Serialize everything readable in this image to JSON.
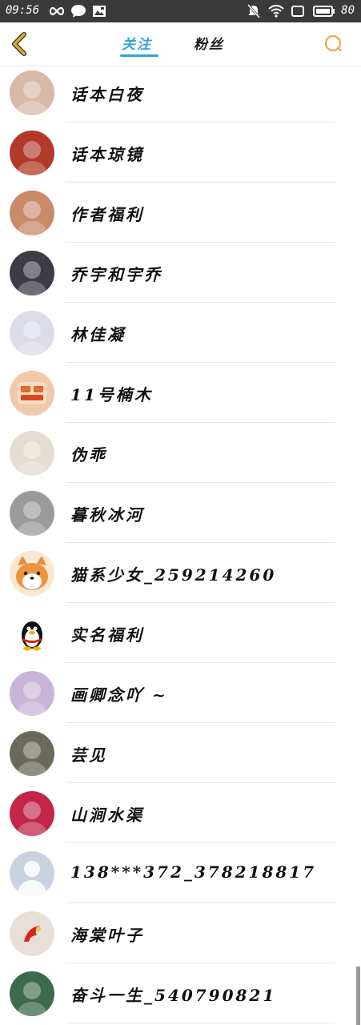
{
  "status_bar": {
    "time": "09:56",
    "battery": "80",
    "icons": [
      "infinity-icon",
      "message-icon",
      "image-icon",
      "mute-icon",
      "wifi-icon",
      "screen-icon",
      "battery-icon"
    ]
  },
  "nav": {
    "back_icon": "chevron-left-icon",
    "tab_follow": "关注",
    "tab_fans": "粉丝",
    "search_icon": "search-icon",
    "accent_color": "#2fa3d7",
    "back_color": "#c49a2a",
    "search_color": "#f0a040"
  },
  "contacts": [
    {
      "name": "话本白夜",
      "avatar_color": "#d8b8a8",
      "avatar_icon": "avatar-girl-red-bow"
    },
    {
      "name": "话本琼镜",
      "avatar_color": "#b33a2a",
      "avatar_icon": "avatar-book-mascot"
    },
    {
      "name": "作者福利",
      "avatar_color": "#c98a6a",
      "avatar_icon": "avatar-anime-girl"
    },
    {
      "name": "乔宇和宇乔",
      "avatar_color": "#3c3c44",
      "avatar_icon": "avatar-photo-dark"
    },
    {
      "name": "林佳凝",
      "avatar_color": "#dcdce8",
      "avatar_icon": "avatar-white-hair-girl"
    },
    {
      "name": "11号楠木",
      "avatar_color": "#f2c8a8",
      "avatar_icon": "avatar-text-logo"
    },
    {
      "name": "伪乖",
      "avatar_color": "#e6ddd2",
      "avatar_icon": "avatar-sketch-girl"
    },
    {
      "name": "暮秋冰河",
      "avatar_color": "#9a9a9a",
      "avatar_icon": "avatar-boy-hat"
    },
    {
      "name": "猫系少女_259214260",
      "avatar_color": "#f0a060",
      "avatar_icon": "avatar-shiba-dog"
    },
    {
      "name": "实名福利",
      "avatar_color": "#ffffff",
      "avatar_icon": "avatar-qq-penguin"
    },
    {
      "name": "画卿念吖 ~",
      "avatar_color": "#c8b4d8",
      "avatar_icon": "avatar-purple-hair-girl"
    },
    {
      "name": "芸见",
      "avatar_color": "#6a6a5a",
      "avatar_icon": "avatar-photo-girl"
    },
    {
      "name": "山涧水渠",
      "avatar_color": "#c2274a",
      "avatar_icon": "avatar-photo-flowers"
    },
    {
      "name": "138***372_378218817",
      "avatar_color": "#c9d3e0",
      "avatar_icon": "avatar-default-person"
    },
    {
      "name": "海棠叶子",
      "avatar_color": "#e8e0d8",
      "avatar_icon": "avatar-red-logo"
    },
    {
      "name": "奋斗一生_540790821",
      "avatar_color": "#3d6a48",
      "avatar_icon": "avatar-photo-nature"
    }
  ]
}
